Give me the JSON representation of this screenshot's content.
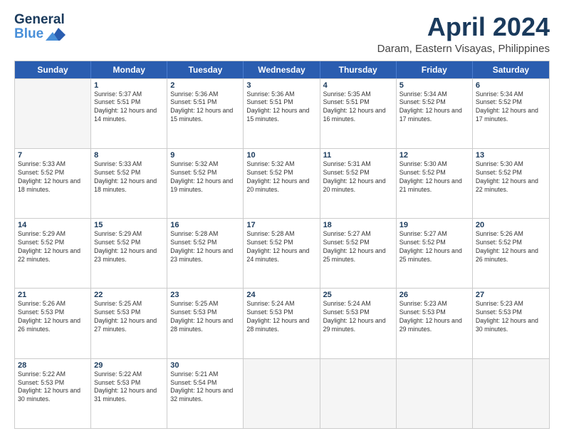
{
  "header": {
    "logo_line1": "General",
    "logo_line2": "Blue",
    "main_title": "April 2024",
    "subtitle": "Daram, Eastern Visayas, Philippines"
  },
  "calendar": {
    "days_of_week": [
      "Sunday",
      "Monday",
      "Tuesday",
      "Wednesday",
      "Thursday",
      "Friday",
      "Saturday"
    ],
    "weeks": [
      [
        {
          "day": "",
          "empty": true
        },
        {
          "day": "1",
          "sunrise": "5:37 AM",
          "sunset": "5:51 PM",
          "daylight": "12 hours and 14 minutes."
        },
        {
          "day": "2",
          "sunrise": "5:36 AM",
          "sunset": "5:51 PM",
          "daylight": "12 hours and 15 minutes."
        },
        {
          "day": "3",
          "sunrise": "5:36 AM",
          "sunset": "5:51 PM",
          "daylight": "12 hours and 15 minutes."
        },
        {
          "day": "4",
          "sunrise": "5:35 AM",
          "sunset": "5:51 PM",
          "daylight": "12 hours and 16 minutes."
        },
        {
          "day": "5",
          "sunrise": "5:34 AM",
          "sunset": "5:52 PM",
          "daylight": "12 hours and 17 minutes."
        },
        {
          "day": "6",
          "sunrise": "5:34 AM",
          "sunset": "5:52 PM",
          "daylight": "12 hours and 17 minutes."
        }
      ],
      [
        {
          "day": "7",
          "sunrise": "5:33 AM",
          "sunset": "5:52 PM",
          "daylight": "12 hours and 18 minutes."
        },
        {
          "day": "8",
          "sunrise": "5:33 AM",
          "sunset": "5:52 PM",
          "daylight": "12 hours and 18 minutes."
        },
        {
          "day": "9",
          "sunrise": "5:32 AM",
          "sunset": "5:52 PM",
          "daylight": "12 hours and 19 minutes."
        },
        {
          "day": "10",
          "sunrise": "5:32 AM",
          "sunset": "5:52 PM",
          "daylight": "12 hours and 20 minutes."
        },
        {
          "day": "11",
          "sunrise": "5:31 AM",
          "sunset": "5:52 PM",
          "daylight": "12 hours and 20 minutes."
        },
        {
          "day": "12",
          "sunrise": "5:30 AM",
          "sunset": "5:52 PM",
          "daylight": "12 hours and 21 minutes."
        },
        {
          "day": "13",
          "sunrise": "5:30 AM",
          "sunset": "5:52 PM",
          "daylight": "12 hours and 22 minutes."
        }
      ],
      [
        {
          "day": "14",
          "sunrise": "5:29 AM",
          "sunset": "5:52 PM",
          "daylight": "12 hours and 22 minutes."
        },
        {
          "day": "15",
          "sunrise": "5:29 AM",
          "sunset": "5:52 PM",
          "daylight": "12 hours and 23 minutes."
        },
        {
          "day": "16",
          "sunrise": "5:28 AM",
          "sunset": "5:52 PM",
          "daylight": "12 hours and 23 minutes."
        },
        {
          "day": "17",
          "sunrise": "5:28 AM",
          "sunset": "5:52 PM",
          "daylight": "12 hours and 24 minutes."
        },
        {
          "day": "18",
          "sunrise": "5:27 AM",
          "sunset": "5:52 PM",
          "daylight": "12 hours and 25 minutes."
        },
        {
          "day": "19",
          "sunrise": "5:27 AM",
          "sunset": "5:52 PM",
          "daylight": "12 hours and 25 minutes."
        },
        {
          "day": "20",
          "sunrise": "5:26 AM",
          "sunset": "5:52 PM",
          "daylight": "12 hours and 26 minutes."
        }
      ],
      [
        {
          "day": "21",
          "sunrise": "5:26 AM",
          "sunset": "5:53 PM",
          "daylight": "12 hours and 26 minutes."
        },
        {
          "day": "22",
          "sunrise": "5:25 AM",
          "sunset": "5:53 PM",
          "daylight": "12 hours and 27 minutes."
        },
        {
          "day": "23",
          "sunrise": "5:25 AM",
          "sunset": "5:53 PM",
          "daylight": "12 hours and 28 minutes."
        },
        {
          "day": "24",
          "sunrise": "5:24 AM",
          "sunset": "5:53 PM",
          "daylight": "12 hours and 28 minutes."
        },
        {
          "day": "25",
          "sunrise": "5:24 AM",
          "sunset": "5:53 PM",
          "daylight": "12 hours and 29 minutes."
        },
        {
          "day": "26",
          "sunrise": "5:23 AM",
          "sunset": "5:53 PM",
          "daylight": "12 hours and 29 minutes."
        },
        {
          "day": "27",
          "sunrise": "5:23 AM",
          "sunset": "5:53 PM",
          "daylight": "12 hours and 30 minutes."
        }
      ],
      [
        {
          "day": "28",
          "sunrise": "5:22 AM",
          "sunset": "5:53 PM",
          "daylight": "12 hours and 30 minutes."
        },
        {
          "day": "29",
          "sunrise": "5:22 AM",
          "sunset": "5:53 PM",
          "daylight": "12 hours and 31 minutes."
        },
        {
          "day": "30",
          "sunrise": "5:21 AM",
          "sunset": "5:54 PM",
          "daylight": "12 hours and 32 minutes."
        },
        {
          "day": "",
          "empty": true
        },
        {
          "day": "",
          "empty": true
        },
        {
          "day": "",
          "empty": true
        },
        {
          "day": "",
          "empty": true
        }
      ]
    ]
  }
}
